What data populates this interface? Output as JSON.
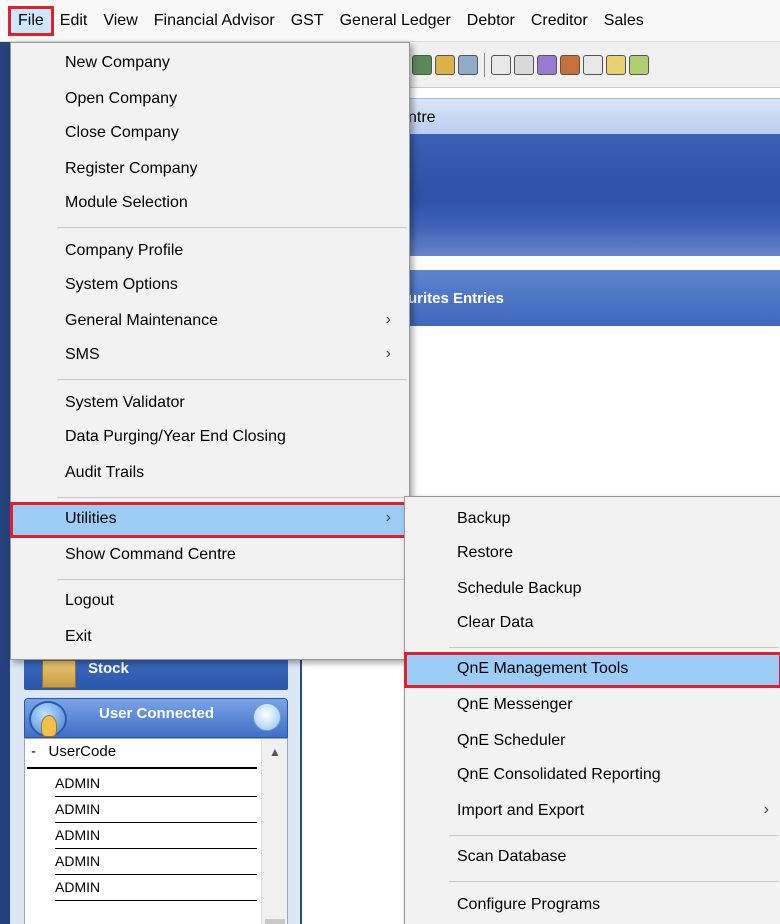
{
  "menubar": {
    "items": [
      "File",
      "Edit",
      "View",
      "Financial Advisor",
      "GST",
      "General Ledger",
      "Debtor",
      "Creditor",
      "Sales"
    ]
  },
  "command_centre": {
    "title_fragment": "ntre"
  },
  "favourites": {
    "title_fragment": "urites Entries"
  },
  "file_menu": {
    "new_company": "New Company",
    "open_company": "Open Company",
    "close_company": "Close Company",
    "register_company": "Register Company",
    "module_selection": "Module Selection",
    "company_profile": "Company Profile",
    "system_options": "System Options",
    "general_maintenance": "General Maintenance",
    "sms": "SMS",
    "system_validator": "System Validator",
    "data_purging": "Data Purging/Year End Closing",
    "audit_trails": "Audit Trails",
    "utilities": "Utilities",
    "show_command_centre": "Show Command Centre",
    "logout": "Logout",
    "exit": "Exit",
    "submenu_arrow": "›"
  },
  "utilities_menu": {
    "backup": "Backup",
    "restore": "Restore",
    "schedule_backup": "Schedule Backup",
    "clear_data": "Clear Data",
    "qne_management_tools": "QnE Management Tools",
    "qne_messenger": "QnE Messenger",
    "qne_scheduler": "QnE Scheduler",
    "qne_consolidated_reporting": "QnE Consolidated Reporting",
    "import_export": "Import and Export",
    "scan_database": "Scan Database",
    "configure_programs": "Configure Programs",
    "submenu_arrow": "›"
  },
  "left_panel": {
    "stock_label": "Stock",
    "user_connected_label": "User Connected",
    "column_header": "UserCode",
    "collapse_marker": "-",
    "users": [
      "ADMIN",
      "ADMIN",
      "ADMIN",
      "ADMIN",
      "ADMIN"
    ]
  },
  "colors": {
    "highlight": "#9ccdf6",
    "annotation_red": "#e0202a",
    "panel_blue": "#2d51a8"
  }
}
